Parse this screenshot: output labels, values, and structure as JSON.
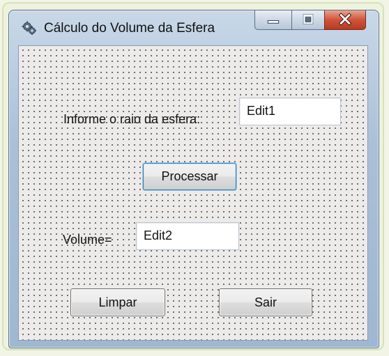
{
  "window": {
    "title": "Cálculo do Volume da Esfera",
    "icon": "gear-app-icon"
  },
  "caption_buttons": {
    "minimize": "minimize-icon",
    "maximize": "maximize-icon",
    "close": "close-icon"
  },
  "form": {
    "radius_label": "Informe o raio da esfera:",
    "radius_input_value": "Edit1",
    "process_button": "Processar",
    "volume_label": "Volume=",
    "volume_input_value": "Edit2",
    "clear_button": "Limpar",
    "exit_button": "Sair"
  },
  "colors": {
    "close_button": "#d0533b",
    "titlebar": "#aac0d8",
    "form_background": "#ecebea"
  }
}
